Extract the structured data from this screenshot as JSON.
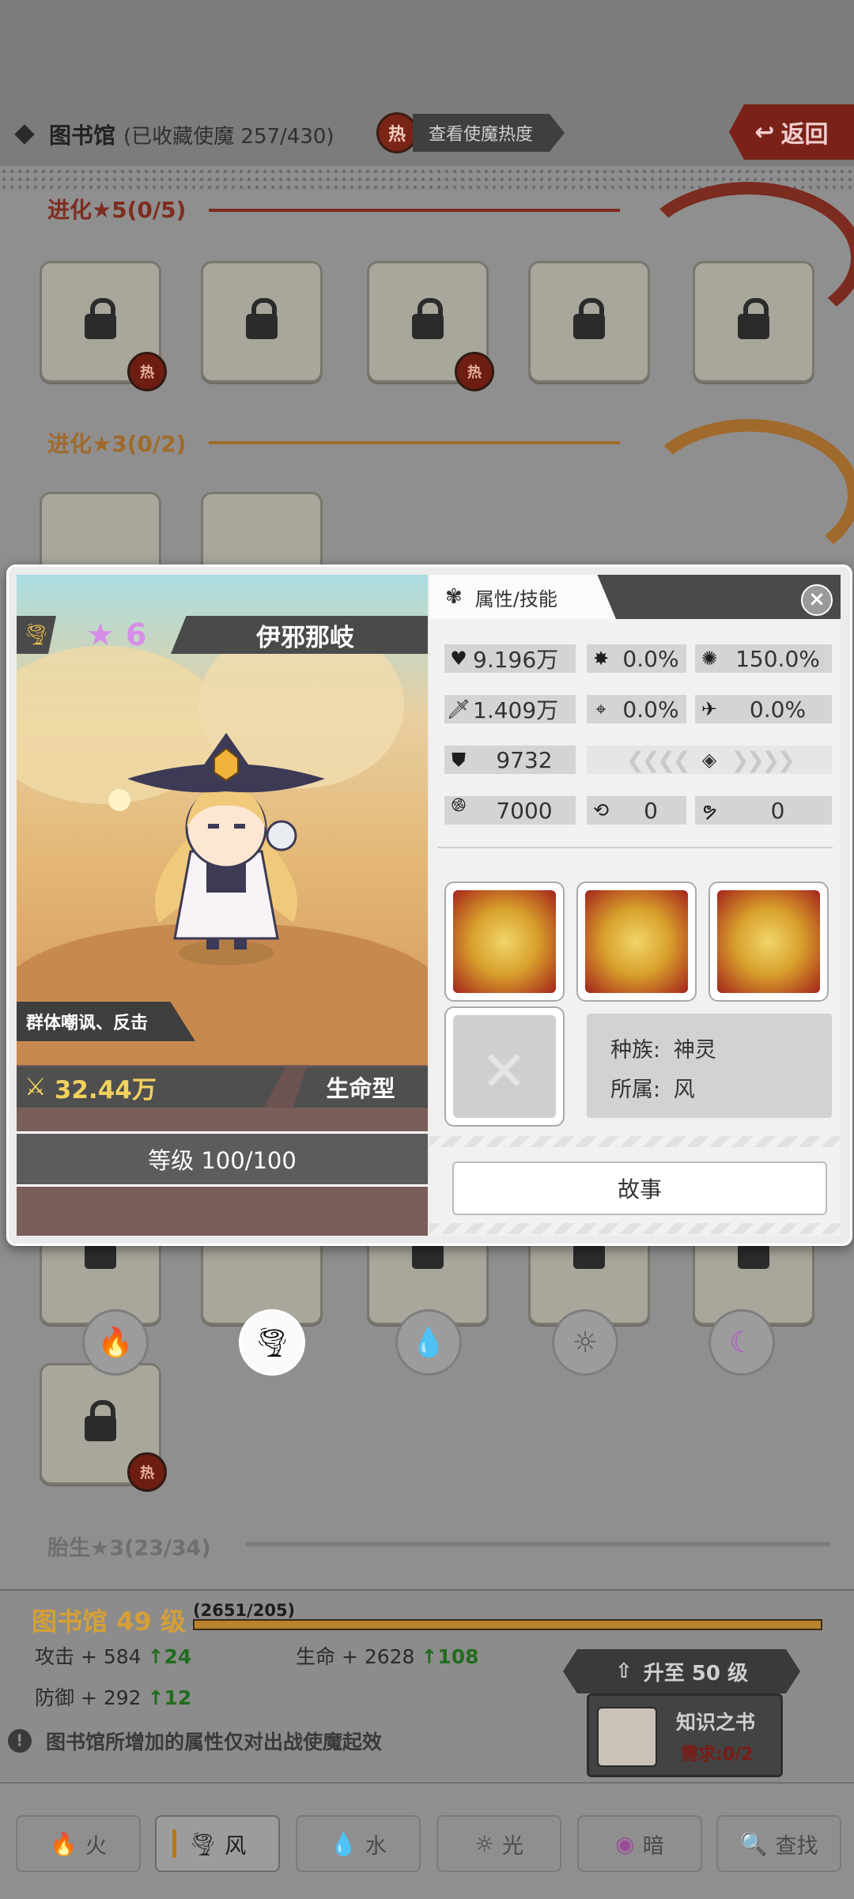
{
  "header": {
    "title": "图书馆",
    "subtitle": "(已收藏使魔 257/430)",
    "hot_badge": "热",
    "hot_button": "查看使魔热度",
    "back_button": "返回"
  },
  "sections": {
    "evo5": "进化★5(0/5)",
    "evo3": "进化★3(0/2)",
    "birth3": "胎生★3(23/34)"
  },
  "slot_hot_badge": "热",
  "detail": {
    "element_icon": "tornado-icon",
    "stars": "6",
    "name": "伊邪那岐",
    "skill_desc": "群体嘲讽、反击",
    "power": "32.44万",
    "type": "生命型",
    "level": "等级 100/100",
    "tab_label": "属性/技能",
    "close": "×",
    "stats": {
      "hp": "9.196万",
      "crit_rate": "0.0%",
      "crit_dmg": "150.0%",
      "atk": "1.409万",
      "accuracy": "0.0%",
      "dodge": "0.0%",
      "def": "9732",
      "speed": "7000",
      "stat_a": "0",
      "stat_b": "0"
    },
    "race_label": "种族:",
    "race": "神灵",
    "belong_label": "所属:",
    "belong": "风",
    "story_button": "故事"
  },
  "elements": [
    {
      "icon": "fire-icon",
      "glyph": "🔥"
    },
    {
      "icon": "wind-icon",
      "glyph": "🌪"
    },
    {
      "icon": "water-icon",
      "glyph": "💧"
    },
    {
      "icon": "light-icon",
      "glyph": "☼"
    },
    {
      "icon": "dark-icon",
      "glyph": "☾"
    }
  ],
  "library": {
    "title": "图书馆 49 级",
    "progress": "(2651/205)",
    "attack": "攻击 + 584",
    "attack_up": "24",
    "hp": "生命 + 2628",
    "hp_up": "108",
    "defense": "防御 + 292",
    "defense_up": "12",
    "upgrade_button": "升至 50 级",
    "book_title": "知识之书",
    "book_req": "需求:0/2",
    "note": "图书馆所增加的属性仅对出战使魔起效"
  },
  "tabs": [
    "火",
    "风",
    "水",
    "光",
    "暗",
    "查找"
  ]
}
